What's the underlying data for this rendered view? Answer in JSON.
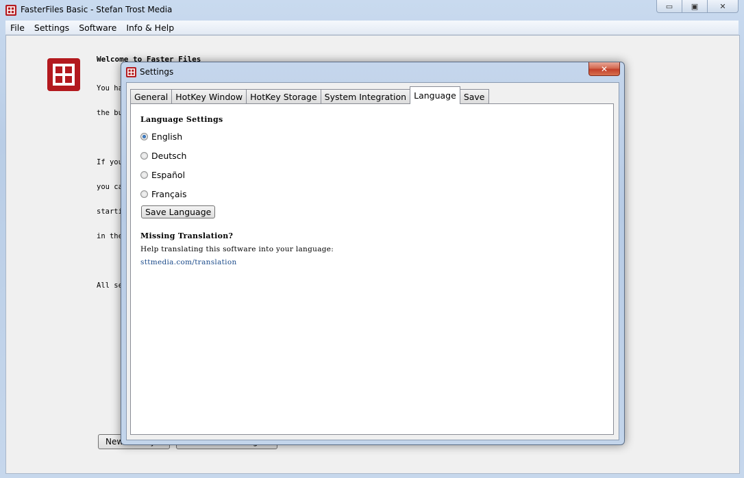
{
  "window": {
    "title": "FasterFiles Basic - Stefan Trost Media",
    "minimize_symbol": "▭",
    "maximize_symbol": "▣",
    "close_symbol": "✕"
  },
  "menu": {
    "items": [
      "File",
      "Settings",
      "Software",
      "Info & Help"
    ]
  },
  "background": {
    "welcome_title": "Welcome to Faster Files",
    "welcome_lines": [
      "You ha",
      "the bu",
      "",
      "If you",
      "you ca",
      "starti",
      "in the",
      "",
      "All se"
    ],
    "new_hotkey_button": "New HotKey...",
    "auto_start_button": "Auto-Start Settings..."
  },
  "dialog": {
    "title": "Settings",
    "close_symbol": "✕",
    "tabs": [
      "General",
      "HotKey Window",
      "HotKey Storage",
      "System Integration",
      "Language",
      "Save"
    ],
    "active_tab": "Language",
    "language_section_title": "Language Settings",
    "languages": [
      "English",
      "Deutsch",
      "Español",
      "Français"
    ],
    "selected_language": "English",
    "save_button": "Save Language",
    "missing_title": "Missing Translation?",
    "help_text": "Help translating this software into your language:",
    "link": "sttmedia.com/translation"
  },
  "colors": {
    "brand_red": "#b3191e",
    "link_blue": "#1a4a8a",
    "close_red": "#c3402a"
  },
  "icons": {
    "app": "faster-files-logo",
    "dialog": "faster-files-logo"
  }
}
